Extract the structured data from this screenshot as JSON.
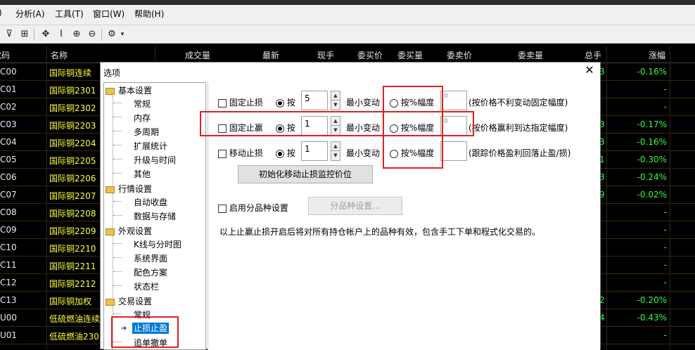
{
  "menubar": {
    "items": [
      "分析(A)",
      "工具(T)",
      "窗口(W)",
      "帮助(H)"
    ]
  },
  "toolbar": {
    "icons": [
      "filter-icon",
      "chart-icon",
      "move-icon",
      "cursor-icon",
      "zoom-in-icon",
      "zoom-out-icon",
      "settings-icon"
    ],
    "dropdown_glyph": "▾",
    "filter_glyph": "⊽",
    "chart_glyph": "⊞",
    "move_glyph": "✥",
    "cursor_glyph": "I",
    "zoom_in_glyph": "⊕",
    "zoom_out_glyph": "⊖",
    "settings_glyph": "⚙"
  },
  "grid": {
    "headers": {
      "code": "代码",
      "name": "名称",
      "volume": "成交量",
      "latest": "最新",
      "current_hand": "现手",
      "bid_price": "委买价",
      "bid_volume": "委买量",
      "ask_price": "委卖价",
      "ask_volume": "委卖量",
      "total_hand": "总手",
      "change_pct": "涨幅"
    },
    "rows": [
      {
        "code": "C00",
        "name": "国际铜连续",
        "extra": "3",
        "chg": "-0.16%"
      },
      {
        "code": "C01",
        "name": "国际铜2301",
        "extra": "",
        "chg": "-"
      },
      {
        "code": "C02",
        "name": "国际铜2302",
        "extra": "",
        "chg": "-"
      },
      {
        "code": "C03",
        "name": "国际铜2203",
        "extra": "3",
        "chg": "-0.17%"
      },
      {
        "code": "C04",
        "name": "国际铜2204",
        "extra": "3",
        "chg": "-0.16%"
      },
      {
        "code": "C05",
        "name": "国际铜2205",
        "extra": "1",
        "chg": "-0.30%"
      },
      {
        "code": "C06",
        "name": "国际铜2206",
        "extra": "3",
        "chg": "-0.24%"
      },
      {
        "code": "C07",
        "name": "国际铜2207",
        "extra": "9",
        "chg": "-0.02%"
      },
      {
        "code": "C08",
        "name": "国际铜2208",
        "extra": "",
        "chg": "-"
      },
      {
        "code": "C09",
        "name": "国际铜2209",
        "extra": "",
        "chg": "-"
      },
      {
        "code": "C10",
        "name": "国际铜2210",
        "extra": "",
        "chg": "-"
      },
      {
        "code": "C11",
        "name": "国际铜2211",
        "extra": "",
        "chg": "-"
      },
      {
        "code": "C12",
        "name": "国际铜2212",
        "extra": "",
        "chg": "-"
      },
      {
        "code": "C13",
        "name": "国际铜加权",
        "extra": "2",
        "chg": "-0.20%"
      },
      {
        "code": "U00",
        "name": "低硫燃油连续",
        "extra": "4",
        "chg": "-0.43%"
      },
      {
        "code": "U01",
        "name": "低硫燃油230",
        "extra": "",
        "chg": "-"
      }
    ]
  },
  "dialog": {
    "title": "选项",
    "close_glyph": "✕",
    "tree": {
      "groups": [
        {
          "label": "基本设置",
          "children": [
            "常规",
            "内存",
            "多周期",
            "扩展统计",
            "升级与时间",
            "其他"
          ]
        },
        {
          "label": "行情设置",
          "children": [
            "自动收盘",
            "数据与存储"
          ]
        },
        {
          "label": "外观设置",
          "children": [
            "K线与分时图",
            "系统界面",
            "配色方案",
            "状态栏"
          ]
        },
        {
          "label": "交易设置",
          "children": [
            "常规",
            "止损止盈",
            "追单撤单"
          ]
        }
      ],
      "selected_arrow": "➔"
    },
    "stop_loss": {
      "label": "固定止损",
      "by_label": "按",
      "value": "5",
      "min_change": "最小变动",
      "pct_label": "按%幅度",
      "pct_value": "0",
      "desc": "(按价格不利变动固定幅度)"
    },
    "take_profit": {
      "label": "固定止赢",
      "by_label": "按",
      "value": "1",
      "min_change": "最小变动",
      "pct_label": "按%幅度",
      "pct_value": "0",
      "desc": "(按价格赢利到达指定幅度)"
    },
    "trailing": {
      "label": "移动止损",
      "by_label": "按",
      "value": "1",
      "min_change": "最小变动",
      "pct_label": "按%幅度",
      "pct_value": "",
      "desc": "(跟踪价格盈利回落止盈/损)"
    },
    "init_button": "初始化移动止损监控价位",
    "per_product_label": "启用分品种设置",
    "per_product_button": "分品种设置...",
    "note": "以上止赢止损开启后将对所有持仓帐户上的品种有效，包含手工下单和程式化交易的。"
  },
  "colors": {
    "highlight": "#e02020",
    "selection": "#0078d7",
    "name_yellow": "#ffff33",
    "change_green": "#33ff33"
  }
}
